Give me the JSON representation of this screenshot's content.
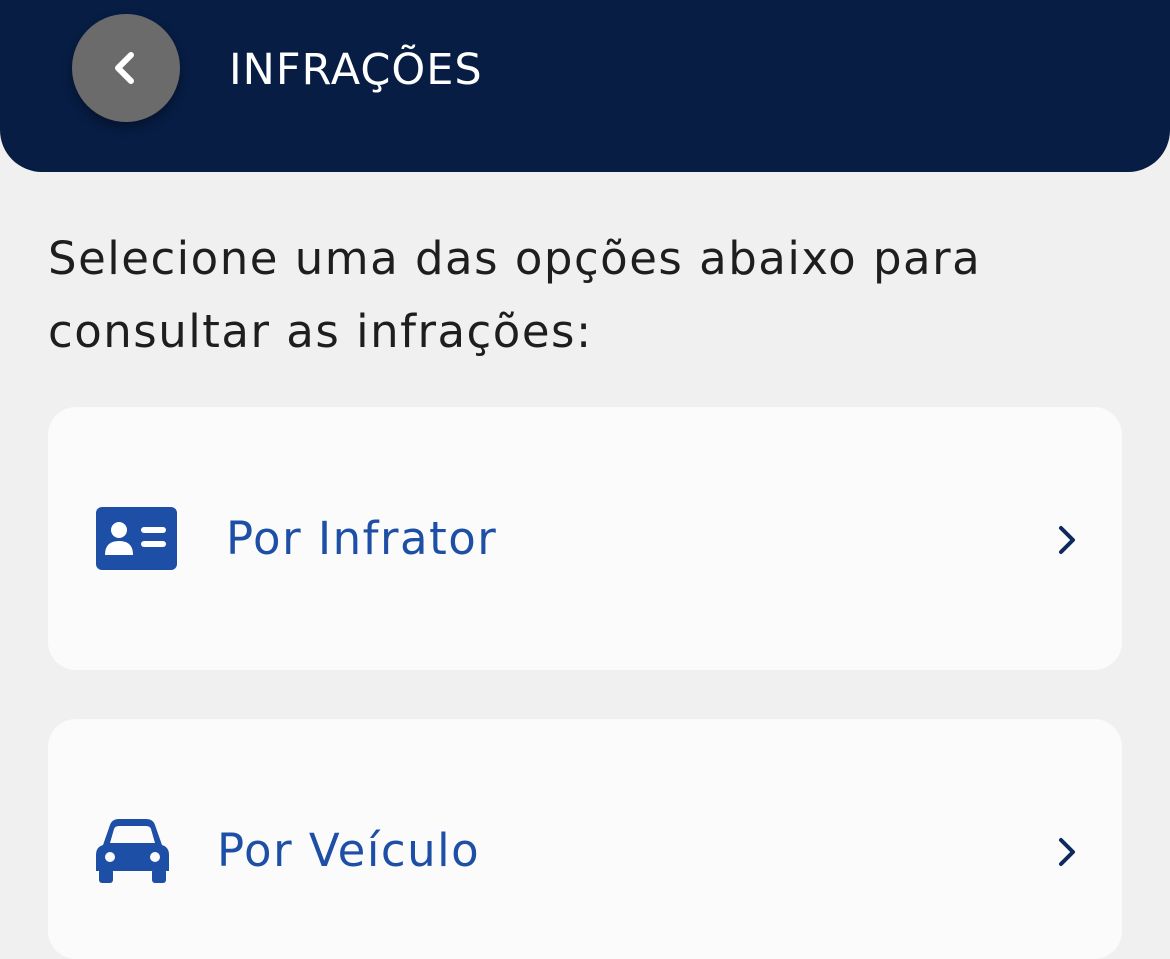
{
  "header": {
    "title": "INFRAÇÕES",
    "back_icon": "chevron-left-icon"
  },
  "instruction": {
    "line1": "Selecione uma das opções abaixo para",
    "line2": "consultar as infrações:"
  },
  "options": [
    {
      "label": "Por Infrator",
      "icon": "id-card-icon"
    },
    {
      "label": "Por Veículo",
      "icon": "car-icon"
    }
  ],
  "colors": {
    "header_bg": "#071d44",
    "accent": "#1d4fa6",
    "background": "#f0f0f0",
    "card_bg": "#fbfbfb",
    "back_button_bg": "#6b6b6b"
  }
}
